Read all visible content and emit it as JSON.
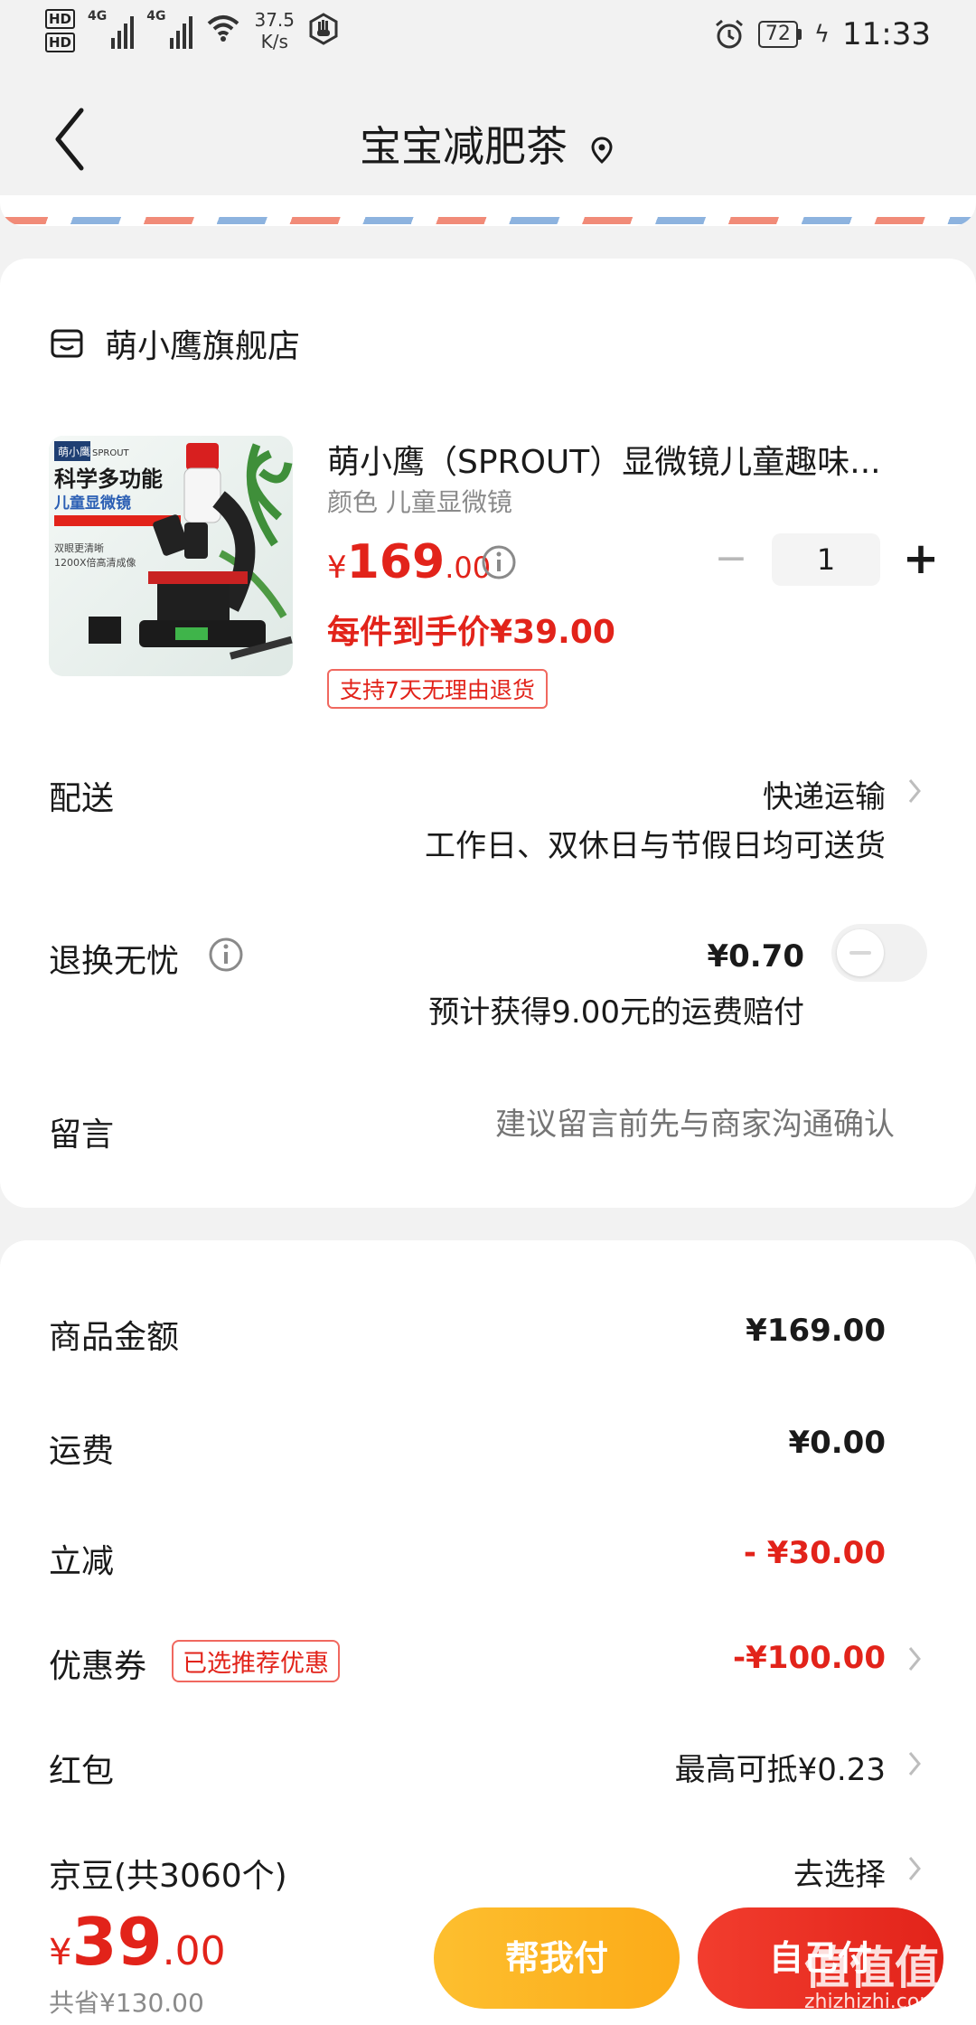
{
  "status_bar": {
    "hd1": "HD",
    "hd2": "HD",
    "signal1": "4G",
    "signal2": "4G",
    "net_speed_value": "37.5",
    "net_speed_unit": "K/s",
    "battery": "72",
    "time": "11:33"
  },
  "header": {
    "title": "宝宝减肥茶"
  },
  "shop": {
    "name": "萌小鹰旗舰店"
  },
  "product": {
    "image_text": {
      "brand": "萌小鹰",
      "brand_en": "SPROUT",
      "headline": "科学多功能",
      "subhead": "儿童显微镜",
      "line1": "双眼更清晰",
      "line2": "1200X倍高清成像"
    },
    "title": "萌小鹰（SPROUT）显微镜儿童趣味...",
    "spec": "颜色 儿童显微镜",
    "price_symbol": "¥",
    "price_int": "169",
    "price_dec": ".00",
    "quantity": "1",
    "unit_price": "每件到手价¥39.00",
    "return_tag": "支持7天无理由退货"
  },
  "delivery": {
    "label": "配送",
    "method": "快递运输",
    "note": "工作日、双休日与节假日均可送货"
  },
  "worry_free": {
    "label": "退换无忧",
    "price": "¥0.70",
    "note": "预计获得9.00元的运费赔付",
    "enabled": false
  },
  "message": {
    "label": "留言",
    "placeholder": "建议留言前先与商家沟通确认"
  },
  "summary": {
    "goods_label": "商品金额",
    "goods_value": "¥169.00",
    "freight_label": "运费",
    "freight_value": "¥0.00",
    "discount_label": "立减",
    "discount_value": "- ¥30.00",
    "coupon_label": "优惠券",
    "coupon_tag": "已选推荐优惠",
    "coupon_value": "-¥100.00",
    "redpacket_label": "红包",
    "redpacket_value": "最高可抵¥0.23",
    "beans_label": "京豆(共3060个)",
    "beans_value": "去选择"
  },
  "bottom": {
    "total_symbol": "¥",
    "total_int": "39",
    "total_dec": ".00",
    "saved": "共省¥130.00",
    "help_pay": "帮我付",
    "self_pay": "自己付",
    "watermark_big": "值值值",
    "watermark_small": "zhizhizhi.com"
  },
  "colors": {
    "accent_red": "#e2231a",
    "help_yellow": "#fcab18",
    "background": "#f2f2f2"
  }
}
